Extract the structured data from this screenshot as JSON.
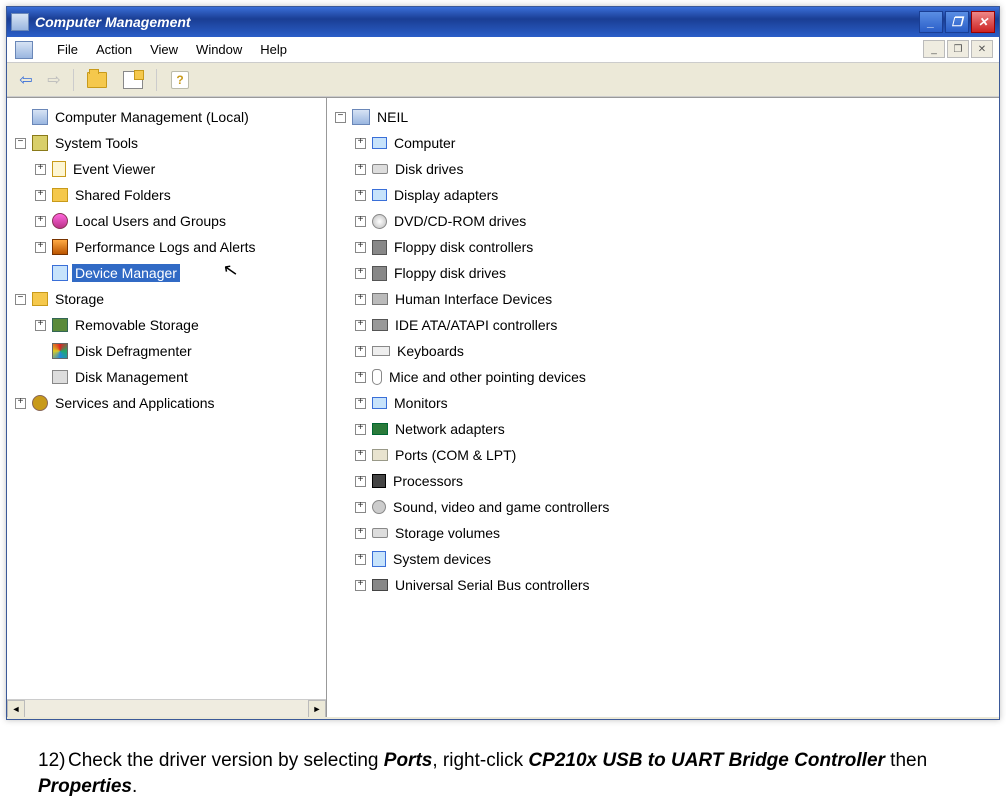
{
  "window": {
    "title": "Computer Management",
    "min": "_",
    "max": "❐",
    "close": "✕"
  },
  "menubar": {
    "items": [
      "File",
      "Action",
      "View",
      "Window",
      "Help"
    ],
    "mdi_min": "_",
    "mdi_restore": "❐",
    "mdi_close": "✕"
  },
  "toolbar": {
    "back": "⇦",
    "fwd": "⇨",
    "help": "?"
  },
  "left_tree": {
    "root": "Computer Management (Local)",
    "system_tools": {
      "label": "System Tools",
      "event_viewer": "Event Viewer",
      "shared_folders": "Shared Folders",
      "local_users": "Local Users and Groups",
      "perf_logs": "Performance Logs and Alerts",
      "device_manager": "Device Manager"
    },
    "storage": {
      "label": "Storage",
      "removable": "Removable Storage",
      "defrag": "Disk Defragmenter",
      "diskmgmt": "Disk Management"
    },
    "services": "Services and Applications"
  },
  "right_tree": {
    "root": "NEIL",
    "items": [
      "Computer",
      "Disk drives",
      "Display adapters",
      "DVD/CD-ROM drives",
      "Floppy disk controllers",
      "Floppy disk drives",
      "Human Interface Devices",
      "IDE ATA/ATAPI controllers",
      "Keyboards",
      "Mice and other pointing devices",
      "Monitors",
      "Network adapters",
      "Ports (COM & LPT)",
      "Processors",
      "Sound, video and game controllers",
      "Storage volumes",
      "System devices",
      "Universal Serial Bus controllers"
    ]
  },
  "instruction": {
    "number": "12)",
    "t1": "Check the driver version by selecting ",
    "b1": "Ports",
    "t2": ", right-click ",
    "b2": "CP210x USB to UART Bridge Controller",
    "t3": " then ",
    "b3": "Properties",
    "t4": "."
  },
  "expanders": {
    "plus": "+",
    "minus": "−"
  },
  "scroll": {
    "left": "◄",
    "right": "►"
  }
}
